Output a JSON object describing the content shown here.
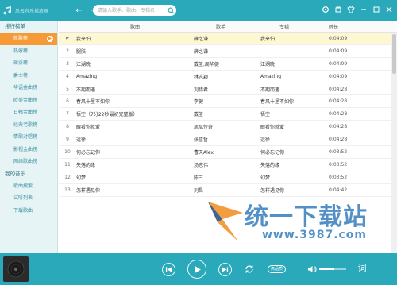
{
  "app": {
    "title": "风云音乐播放器"
  },
  "search": {
    "placeholder": "请输入歌手、歌曲、专辑名"
  },
  "sidebar": {
    "sections": [
      {
        "label": "排行榜单",
        "items": [
          "新歌榜",
          "热歌榜",
          "飙涨榜",
          "爵士榜",
          "华语金曲榜",
          "欧美金曲榜",
          "日韩金曲榜",
          "经典老歌榜",
          "情歌对唱榜",
          "影视金曲榜",
          "网络歌曲榜"
        ]
      },
      {
        "label": "我的音乐",
        "items": [
          "歌曲搜索",
          "试听列表",
          "下载歌曲"
        ]
      }
    ],
    "active_item": "新歌榜"
  },
  "table": {
    "headers": {
      "song": "歌曲",
      "singer": "歌手",
      "album": "专辑",
      "duration": "时长"
    },
    "rows": [
      {
        "no": "",
        "song": "我来怕",
        "singer": "薛之谦",
        "album": "我来怕",
        "duration": "0:04:09"
      },
      {
        "no": "2",
        "song": "腿肤",
        "singer": "薛之谦",
        "album": "",
        "duration": "0:04:09"
      },
      {
        "no": "3",
        "song": "江湖晚",
        "singer": "戴荃,周华健",
        "album": "江湖晚",
        "duration": "0:04:09"
      },
      {
        "no": "4",
        "song": "Amazing",
        "singer": "林志颖",
        "album": "Amazing",
        "duration": "0:04:09"
      },
      {
        "no": "5",
        "song": "不期而遇",
        "singer": "刘惜君",
        "album": "不期而遇",
        "duration": "0:04:28"
      },
      {
        "no": "6",
        "song": "春风十里不如你",
        "singer": "李健",
        "album": "春风十里不如你",
        "duration": "0:04:28"
      },
      {
        "no": "7",
        "song": "悟空（7分22秒最初完整版）",
        "singer": "戴荃",
        "album": "悟空",
        "duration": "0:04:28"
      },
      {
        "no": "8",
        "song": "眼看你就爱",
        "singer": "凤凰传奇",
        "album": "眼看你就爱",
        "duration": "0:04:28"
      },
      {
        "no": "9",
        "song": "远徐",
        "singer": "张信哲",
        "album": "远徐",
        "duration": "0:04:28"
      },
      {
        "no": "10",
        "song": "何必忘记你",
        "singer": "曹天Alex",
        "album": "何必忘记你",
        "duration": "0:03:52"
      },
      {
        "no": "11",
        "song": "失落的缘",
        "singer": "汤志伟",
        "album": "失落的缘",
        "duration": "0:03:52"
      },
      {
        "no": "12",
        "song": "幻梦",
        "singer": "陈三",
        "album": "幻梦",
        "duration": "0:03:52"
      },
      {
        "no": "13",
        "song": "怎样遇见你",
        "singer": "刘昌",
        "album": "怎样遇见你",
        "duration": "0:04:42"
      }
    ]
  },
  "player": {
    "quality_label": "高品质",
    "lyrics_label": "词",
    "volume": 0.55
  },
  "watermark": {
    "brand": "统一下载站",
    "url": "www.3987.com"
  },
  "colors": {
    "accent": "#2aa9bb",
    "active": "#f59a35",
    "sidebar_bg": "#e6f4f6",
    "highlight_row": "#fdf8d2"
  },
  "icons": [
    "back-icon",
    "forward-icon",
    "search-icon",
    "gear-icon",
    "skin-icon",
    "shirt-icon",
    "minimize-icon",
    "maximize-icon",
    "close-icon",
    "prev-icon",
    "play-icon",
    "next-icon",
    "repeat-icon",
    "volume-icon"
  ]
}
